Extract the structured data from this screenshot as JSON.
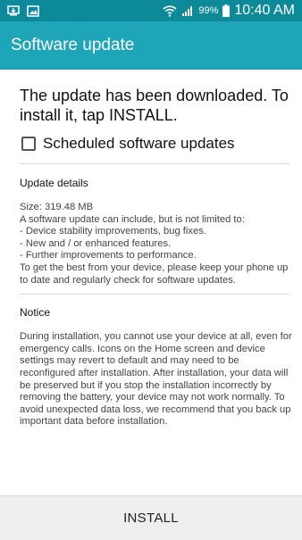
{
  "status_bar": {
    "icons": [
      "download-notification-icon",
      "photo-notification-icon",
      "wifi-icon",
      "signal-icon",
      "battery-icon"
    ],
    "battery": "99%",
    "time": "10:40 AM"
  },
  "app_bar": {
    "title": "Software update"
  },
  "main": {
    "headline": "The update has been downloaded. To install it, tap INSTALL.",
    "checkbox": {
      "label": "Scheduled software updates",
      "checked": false
    },
    "update_details": {
      "title": "Update details",
      "body": "Size: 319.48 MB\nA software update can include, but is not limited to:\n - Device stability improvements, bug fixes.\n - New and / or enhanced features.\n - Further improvements to performance.\nTo get the best from your device, please keep your phone up to date and regularly check for software updates."
    },
    "notice": {
      "title": "Notice",
      "body": "During installation, you cannot use your device at all, even for emergency calls. Icons on the Home screen and device settings may revert to default and may need to be reconfigured after installation. After installation, your data will be preserved but if you stop the installation incorrectly by removing the battery, your device may not work normally. To avoid unexpected data loss, we recommend that you back up important data before installation."
    }
  },
  "footer": {
    "install_label": "INSTALL"
  },
  "colors": {
    "status_bar": "#0d8a99",
    "app_bar": "#1ea6b8",
    "footer": "#eeeeee"
  }
}
